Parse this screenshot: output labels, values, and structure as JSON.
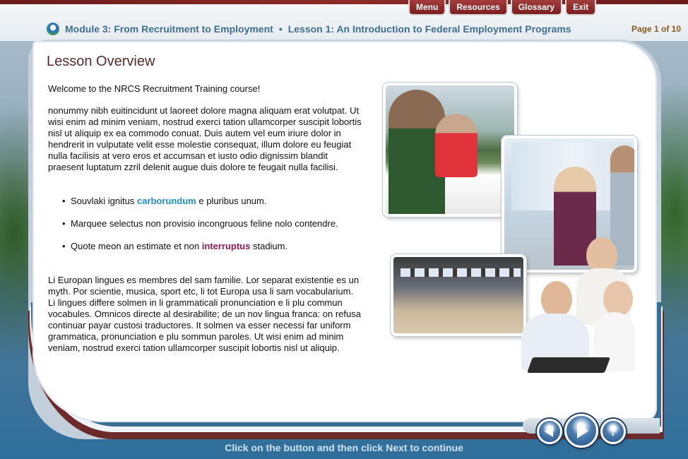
{
  "nav_tabs": [
    "Menu",
    "Resources",
    "Glossary",
    "Exit"
  ],
  "header": {
    "module_title": "Module 3: From Recruitment to Employment",
    "separator": "•",
    "lesson_title": "Lesson 1: An Introduction to Federal Employment Programs",
    "page_counter": "Page 1 of 10"
  },
  "content": {
    "heading": "Lesson Overview",
    "welcome": "Welcome to the NRCS Recruitment Training course!",
    "para1": "nonummy nibh euitincidunt ut laoreet dolore magna aliquam erat volutpat. Ut wisi enim ad minim veniam, nostrud exerci tation ullamcorper suscipit lobortis nisl ut aliquip ex ea commodo conuat. Duis autem vel eum iriure dolor in hendrerit in vulputate velit esse molestie consequat, illum dolore eu feugiat nulla facilisis at vero eros et accumsan et iusto odio dignissim blandit praesent luptatum zzril delenit augue duis dolore te feugait nulla facilisi.",
    "bullets": [
      {
        "pre": "Souvlaki ignitus ",
        "highlight": "carborundum",
        "post": " e pluribus unum."
      },
      {
        "pre": "Marquee selectus non provisio incongruous feline nolo contendre.",
        "highlight": "",
        "post": ""
      },
      {
        "pre": "Quote meon an estimate et non ",
        "highlight": "interruptus",
        "post": " stadium."
      }
    ],
    "para2": "Li Europan lingues es membres del sam familie. Lor separat existentie es un myth. Por scientie, musica, sport etc, li tot Europa usa li sam vocabularium. Li lingues differe solmen in li grammaticali pronunciation e li plu commun vocabules. Omnicos directe al desirabilite; de un nov lingua franca: on refusa continuar payar custosi traductores. It solmen va esser necessi far uniform grammatica, pronunciation e plu sommun paroles. Ut wisi enim ad minim veniam, nostrud exerci tation ullamcorper suscipit lobortis nisl ut aliquip."
  },
  "footer": {
    "instruction": "Click on the button and then click Next to continue",
    "help_label": "?"
  },
  "colors": {
    "tab_red": "#8e2a2a",
    "title_blue": "#3d6f93",
    "highlight_blue": "#1e8fc8",
    "highlight_purple": "#8b1a55",
    "page_counter": "#8a5a1a"
  },
  "icons": [
    "nrcs-logo-icon",
    "prev-arrow-icon",
    "next-arrow-icon",
    "help-icon"
  ]
}
